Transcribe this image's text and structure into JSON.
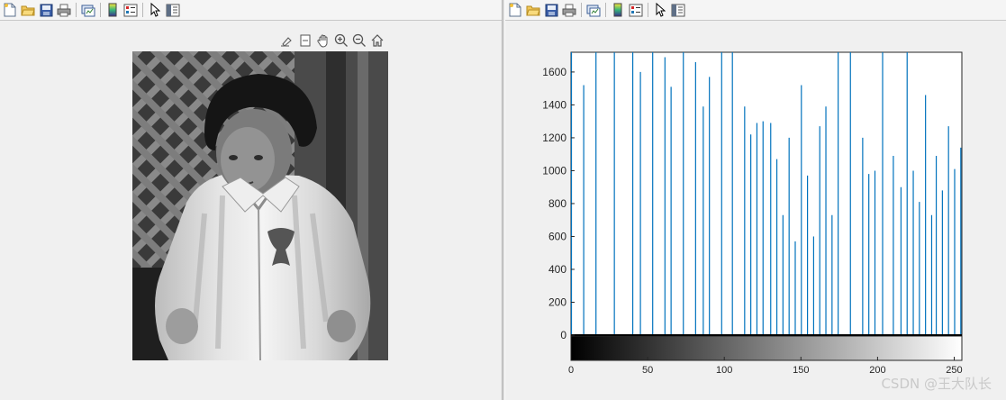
{
  "left_window": {
    "toolbar": {
      "icons": [
        "new-figure-icon",
        "open-file-icon",
        "save-icon",
        "print-icon",
        "link-plot-icon",
        "insert-colorbar-icon",
        "insert-legend-icon",
        "edit-plot-arrow-icon",
        "property-inspector-icon"
      ]
    },
    "axes_toolbar": {
      "icons": [
        "brush-data-icon",
        "data-tips-icon",
        "pan-hand-icon",
        "zoom-in-icon",
        "zoom-out-icon",
        "restore-view-home-icon"
      ]
    },
    "image": {
      "description_name": "grayscale-photo"
    }
  },
  "right_window": {
    "toolbar": {
      "icons": [
        "new-figure-icon",
        "open-file-icon",
        "save-icon",
        "print-icon",
        "link-plot-icon",
        "insert-colorbar-icon",
        "insert-legend-icon",
        "edit-plot-arrow-icon",
        "property-inspector-icon"
      ]
    }
  },
  "chart_data": {
    "type": "bar",
    "style": "stem",
    "x": [
      0,
      8,
      16,
      28,
      40,
      45,
      53,
      61,
      65,
      73,
      81,
      86,
      90,
      98,
      105,
      113,
      117,
      121,
      125,
      130,
      134,
      138,
      142,
      146,
      150,
      154,
      158,
      162,
      166,
      170,
      174,
      182,
      190,
      194,
      198,
      203,
      210,
      215,
      219,
      223,
      227,
      231,
      235,
      238,
      242,
      246,
      250,
      254
    ],
    "values": [
      1720,
      1520,
      1720,
      1720,
      1720,
      1600,
      1720,
      1690,
      1510,
      1720,
      1660,
      1390,
      1570,
      1720,
      1720,
      1390,
      1220,
      1290,
      1300,
      1290,
      1070,
      730,
      1200,
      570,
      1520,
      970,
      600,
      1270,
      1390,
      730,
      1720,
      1720,
      1200,
      980,
      1000,
      1720,
      1090,
      900,
      1720,
      1000,
      810,
      1460,
      730,
      1090,
      880,
      1270,
      1010,
      1140
    ],
    "xlim": [
      0,
      255
    ],
    "ylim": [
      -150,
      1720
    ],
    "y_ticks": [
      "0",
      "200",
      "400",
      "600",
      "800",
      "1000",
      "1200",
      "1400",
      "1600"
    ],
    "x_ticks": [
      "0",
      "50",
      "100",
      "150",
      "200",
      "250"
    ],
    "colorbar": "gray-gradient",
    "line_color": "#0072bd",
    "grid": false,
    "title": "",
    "xlabel": "",
    "ylabel": ""
  },
  "watermark": {
    "text": "CSDN @王大队长"
  }
}
